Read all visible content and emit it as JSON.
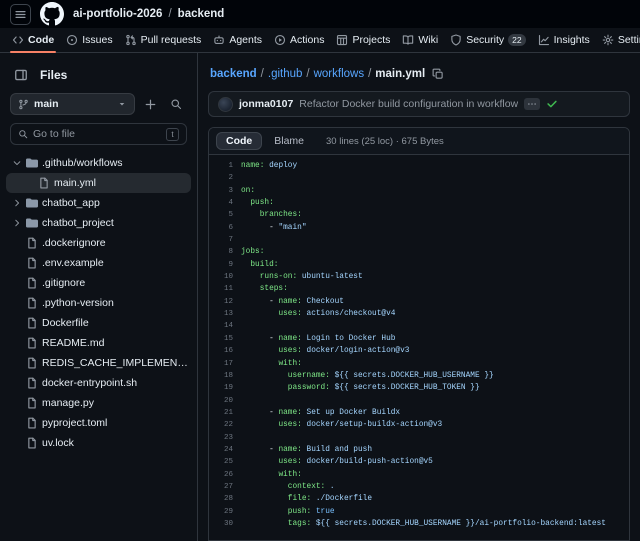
{
  "topbar": {
    "repo_owner": "ai-portfolio-2026",
    "separator": "/",
    "repo_name": "backend"
  },
  "nav_tabs": [
    {
      "label": "Code",
      "icon": "code",
      "active": true
    },
    {
      "label": "Issues",
      "icon": "issues",
      "active": false
    },
    {
      "label": "Pull requests",
      "icon": "pull-request",
      "active": false
    },
    {
      "label": "Agents",
      "icon": "agents",
      "active": false
    },
    {
      "label": "Actions",
      "icon": "actions",
      "active": false
    },
    {
      "label": "Projects",
      "icon": "projects",
      "active": false
    },
    {
      "label": "Wiki",
      "icon": "wiki",
      "active": false
    },
    {
      "label": "Security",
      "icon": "security",
      "active": false,
      "badge": "22"
    },
    {
      "label": "Insights",
      "icon": "insights",
      "active": false
    },
    {
      "label": "Settings",
      "icon": "settings",
      "active": false
    }
  ],
  "sidebar": {
    "title": "Files",
    "branch_button": {
      "label": "main"
    },
    "search": {
      "placeholder": "Go to file",
      "key_hint": "t"
    },
    "tree": [
      {
        "name": ".github/workflows",
        "type": "folder",
        "level": 0,
        "expanded": true,
        "selected": false
      },
      {
        "name": "main.yml",
        "type": "file",
        "level": 1,
        "selected": true
      },
      {
        "name": "chatbot_app",
        "type": "folder",
        "level": 0,
        "expanded": false,
        "selected": false
      },
      {
        "name": "chatbot_project",
        "type": "folder",
        "level": 0,
        "expanded": false,
        "selected": false
      },
      {
        "name": ".dockerignore",
        "type": "file",
        "level": 0,
        "selected": false
      },
      {
        "name": ".env.example",
        "type": "file",
        "level": 0,
        "selected": false
      },
      {
        "name": ".gitignore",
        "type": "file",
        "level": 0,
        "selected": false
      },
      {
        "name": ".python-version",
        "type": "file",
        "level": 0,
        "selected": false
      },
      {
        "name": "Dockerfile",
        "type": "file",
        "level": 0,
        "selected": false
      },
      {
        "name": "README.md",
        "type": "file",
        "level": 0,
        "selected": false
      },
      {
        "name": "REDIS_CACHE_IMPLEMENTA...",
        "type": "file",
        "level": 0,
        "selected": false
      },
      {
        "name": "docker-entrypoint.sh",
        "type": "file",
        "level": 0,
        "selected": false
      },
      {
        "name": "manage.py",
        "type": "file",
        "level": 0,
        "selected": false
      },
      {
        "name": "pyproject.toml",
        "type": "file",
        "level": 0,
        "selected": false
      },
      {
        "name": "uv.lock",
        "type": "file",
        "level": 0,
        "selected": false
      }
    ]
  },
  "main": {
    "breadcrumb": [
      {
        "label": "backend",
        "type": "link"
      },
      {
        "label": ".github",
        "type": "link"
      },
      {
        "label": "workflows",
        "type": "link"
      },
      {
        "label": "main.yml",
        "type": "current"
      }
    ],
    "commit": {
      "author": "jonma0107",
      "message": "Refactor Docker build configuration in workflow",
      "status": "success"
    },
    "code_header": {
      "tabs": [
        {
          "label": "Code",
          "active": true
        },
        {
          "label": "Blame",
          "active": false
        }
      ],
      "meta": "30 lines (25 loc) · 675 Bytes"
    }
  },
  "code_lines": [
    [
      [
        "k",
        "name:"
      ],
      [
        "v",
        " deploy"
      ]
    ],
    [],
    [
      [
        "k",
        "on:"
      ]
    ],
    [
      [
        "p",
        "  "
      ],
      [
        "k",
        "push:"
      ]
    ],
    [
      [
        "p",
        "    "
      ],
      [
        "k",
        "branches:"
      ]
    ],
    [
      [
        "p",
        "      - "
      ],
      [
        "v",
        "\"main\""
      ]
    ],
    [],
    [
      [
        "k",
        "jobs:"
      ]
    ],
    [
      [
        "p",
        "  "
      ],
      [
        "k",
        "build:"
      ]
    ],
    [
      [
        "p",
        "    "
      ],
      [
        "k",
        "runs-on:"
      ],
      [
        "v",
        " ubuntu-latest"
      ]
    ],
    [
      [
        "p",
        "    "
      ],
      [
        "k",
        "steps:"
      ]
    ],
    [
      [
        "p",
        "      - "
      ],
      [
        "k",
        "name:"
      ],
      [
        "v",
        " Checkout"
      ]
    ],
    [
      [
        "p",
        "        "
      ],
      [
        "k",
        "uses:"
      ],
      [
        "v",
        " actions/checkout@v4"
      ]
    ],
    [],
    [
      [
        "p",
        "      - "
      ],
      [
        "k",
        "name:"
      ],
      [
        "v",
        " Login to Docker Hub"
      ]
    ],
    [
      [
        "p",
        "        "
      ],
      [
        "k",
        "uses:"
      ],
      [
        "v",
        " docker/login-action@v3"
      ]
    ],
    [
      [
        "p",
        "        "
      ],
      [
        "k",
        "with:"
      ]
    ],
    [
      [
        "p",
        "          "
      ],
      [
        "k",
        "username:"
      ],
      [
        "v",
        " ${{ secrets.DOCKER_HUB_USERNAME }}"
      ]
    ],
    [
      [
        "p",
        "          "
      ],
      [
        "k",
        "password:"
      ],
      [
        "v",
        " ${{ secrets.DOCKER_HUB_TOKEN }}"
      ]
    ],
    [],
    [
      [
        "p",
        "      - "
      ],
      [
        "k",
        "name:"
      ],
      [
        "v",
        " Set up Docker Buildx"
      ]
    ],
    [
      [
        "p",
        "        "
      ],
      [
        "k",
        "uses:"
      ],
      [
        "v",
        " docker/setup-buildx-action@v3"
      ]
    ],
    [],
    [
      [
        "p",
        "      - "
      ],
      [
        "k",
        "name:"
      ],
      [
        "v",
        " Build and push"
      ]
    ],
    [
      [
        "p",
        "        "
      ],
      [
        "k",
        "uses:"
      ],
      [
        "v",
        " docker/build-push-action@v5"
      ]
    ],
    [
      [
        "p",
        "        "
      ],
      [
        "k",
        "with:"
      ]
    ],
    [
      [
        "p",
        "          "
      ],
      [
        "k",
        "context:"
      ],
      [
        "v",
        " ."
      ]
    ],
    [
      [
        "p",
        "          "
      ],
      [
        "k",
        "file:"
      ],
      [
        "v",
        " ./Dockerfile"
      ]
    ],
    [
      [
        "p",
        "          "
      ],
      [
        "k",
        "push:"
      ],
      [
        "c",
        " true"
      ]
    ],
    [
      [
        "p",
        "          "
      ],
      [
        "k",
        "tags:"
      ],
      [
        "v",
        " ${{ secrets.DOCKER_HUB_USERNAME }}/ai-portfolio-backend:latest"
      ]
    ]
  ],
  "colors": {
    "accent_underline": "#f78166",
    "link": "#58a6ff",
    "check_green": "#3fb950",
    "yaml_key": "#7ee787",
    "yaml_string": "#a5d6ff",
    "yaml_constant": "#79c0ff"
  }
}
